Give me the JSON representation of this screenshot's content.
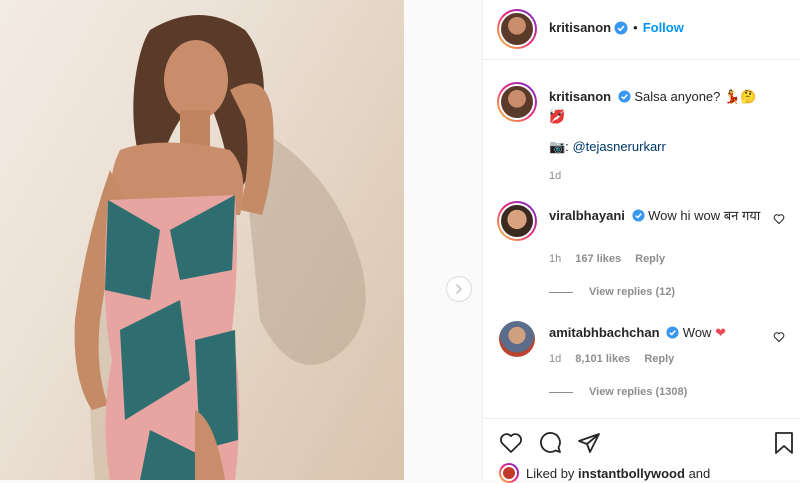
{
  "post": {
    "username": "kritisanon",
    "follow_label": "Follow",
    "caption_text": "Salsa anyone?",
    "caption_emojis": "💃🤔👀",
    "caption_line2": "💋",
    "credit_prefix": "📷:",
    "credit_handle": "@tejasnerurkarr",
    "caption_time": "1d"
  },
  "comments": [
    {
      "username": "viralbhayani",
      "text": "Wow hi wow बन गया",
      "time": "1h",
      "likes": "167 likes",
      "reply_label": "Reply",
      "view_replies": "View replies (12)"
    },
    {
      "username": "amitabhbachchan",
      "text": "Wow",
      "heart": "❤",
      "time": "1d",
      "likes": "8,101 likes",
      "reply_label": "Reply",
      "view_replies": "View replies (1308)"
    }
  ],
  "footer": {
    "liked_prefix": "Liked by",
    "liked_user": "instantbollywood",
    "liked_suffix": "and"
  },
  "colors": {
    "accent": "#0095f6",
    "verified": "#3897f0",
    "heart": "#ed4956",
    "muted": "#8e8e8e"
  }
}
